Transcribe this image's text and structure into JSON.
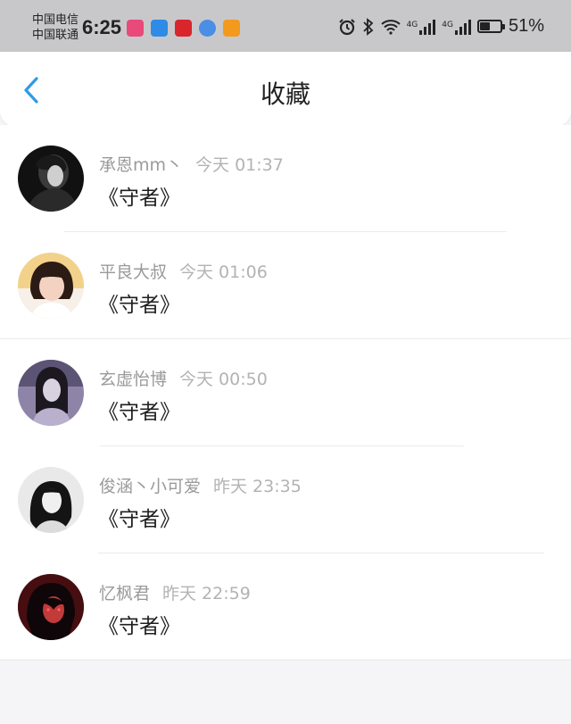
{
  "status_bar": {
    "carrier1": "中国电信",
    "carrier2": "中国联通",
    "time": "6:25",
    "net1": "4G",
    "net2": "4G",
    "battery_percent": "51%",
    "battery_level": 0.51,
    "app_icon_colors": [
      "#e94a7a",
      "#2e8be6",
      "#d9262d",
      "#4a8ee6",
      "#f39a1e"
    ]
  },
  "header": {
    "title": "收藏",
    "accent_color": "#2e9be6"
  },
  "favorites": [
    {
      "user": "承恩mm丶",
      "time": "今天 01:37",
      "content": "《守者》"
    },
    {
      "user": "平良大叔",
      "time": "今天 01:06",
      "content": "《守者》"
    },
    {
      "user": "玄虚怡博",
      "time": "今天 00:50",
      "content": "《守者》"
    },
    {
      "user": "俊涵丶小可爱",
      "time": "昨天 23:35",
      "content": "《守者》"
    },
    {
      "user": "忆枫君",
      "time": "昨天 22:59",
      "content": "《守者》"
    }
  ]
}
